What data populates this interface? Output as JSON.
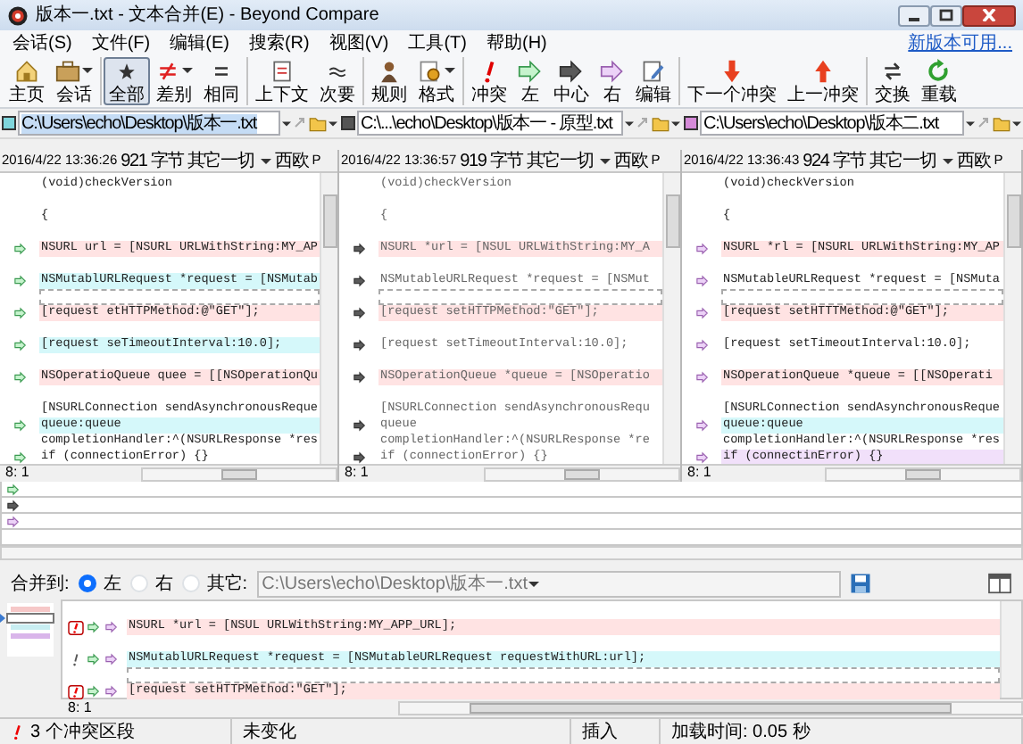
{
  "window": {
    "title": "版本一.txt - 文本合并(E) - Beyond Compare"
  },
  "menu": [
    "会话(S)",
    "文件(F)",
    "编辑(E)",
    "搜索(R)",
    "视图(V)",
    "工具(T)",
    "帮助(H)"
  ],
  "update_link": "新版本可用...",
  "toolbar": [
    [
      {
        "label": "主页",
        "kind": "home"
      },
      {
        "label": "会话",
        "kind": "session",
        "dropdown": true
      }
    ],
    [
      {
        "label": "全部",
        "kind": "all",
        "selected": true
      },
      {
        "label": "差别",
        "kind": "diff",
        "dropdown": true,
        "selected": false
      },
      {
        "label": "相同",
        "kind": "same",
        "selected": false
      }
    ],
    [
      {
        "label": "上下文",
        "kind": "context"
      },
      {
        "label": "次要",
        "kind": "minor"
      }
    ],
    [
      {
        "label": "规则",
        "kind": "rules"
      },
      {
        "label": "格式",
        "kind": "format",
        "dropdown": true
      }
    ],
    [
      {
        "label": "冲突",
        "kind": "conflict"
      },
      {
        "label": "左",
        "kind": "left"
      },
      {
        "label": "中心",
        "kind": "center"
      },
      {
        "label": "右",
        "kind": "right"
      },
      {
        "label": "编辑",
        "kind": "edit"
      }
    ],
    [
      {
        "label": "下一个冲突",
        "kind": "next"
      },
      {
        "label": "上一冲突",
        "kind": "prev"
      }
    ],
    [
      {
        "label": "交换",
        "kind": "swap"
      },
      {
        "label": "重载",
        "kind": "reload"
      }
    ]
  ],
  "panes": [
    {
      "kind": "left",
      "color": "#7fd6dc",
      "path": "C:\\Users\\echo\\Desktop\\版本一.txt",
      "path_selected": true,
      "date": "2016/4/22 13:36:26",
      "size": "921 字节",
      "filter": "其它一切",
      "encoding": "西欧",
      "mode": "P",
      "position": "8: 1",
      "lines": [
        {
          "text": "(void)checkVersion",
          "kind": "same",
          "arrow": false
        },
        {
          "kind": "same"
        },
        {
          "text": "{",
          "kind": "same",
          "arrow": false
        },
        {
          "kind": "same"
        },
        {
          "text": "NSURL url = [NSURL URLWithString:MY_AP",
          "kind": "conflict",
          "arrow": true
        },
        {
          "kind": "same"
        },
        {
          "text": "NSMutablURLRequest *request = [NSMutab",
          "kind": "left",
          "arrow": true
        },
        {
          "kind": "gap"
        },
        {
          "text": "[request etHTTPMethod:@\"GET\"];",
          "kind": "conflict",
          "arrow": true
        },
        {
          "kind": "same"
        },
        {
          "text": "[request seTimeoutInterval:10.0];",
          "kind": "left",
          "arrow": true
        },
        {
          "kind": "same"
        },
        {
          "text": "NSOperatioQueue quee = [[NSOperationQu",
          "kind": "conflict",
          "arrow": true
        },
        {
          "kind": "same"
        },
        {
          "text": "[NSURLConnection sendAsynchronousReque",
          "kind": "same",
          "arrow": false
        },
        {
          "text": "queue:queue",
          "kind": "left",
          "arrow": true
        },
        {
          "text": "completionHandler:^(NSURLResponse *res",
          "kind": "same",
          "arrow": false
        },
        {
          "text": "if (connectionError) {}",
          "kind": "same",
          "arrow": true
        }
      ]
    },
    {
      "kind": "base",
      "color": "#555555",
      "path": "C:\\...\\echo\\Desktop\\版本一 - 原型.txt",
      "path_selected": false,
      "date": "2016/4/22 13:36:57",
      "size": "919 字节",
      "filter": "其它一切",
      "encoding": "西欧",
      "mode": "P",
      "position": "8: 1",
      "lines": [
        {
          "text": "(void)checkVersion",
          "kind": "same",
          "arrow": false
        },
        {
          "kind": "same"
        },
        {
          "text": "{",
          "kind": "same",
          "arrow": false
        },
        {
          "kind": "same"
        },
        {
          "text": "NSURL *url = [NSUL URLWithString:MY_A",
          "kind": "conflict",
          "arrow": true
        },
        {
          "kind": "same"
        },
        {
          "text": "NSMutableURLRequest *request = [NSMut",
          "kind": "same",
          "arrow": true
        },
        {
          "kind": "gap"
        },
        {
          "text": "[request setHTTPMethod:\"GET\"];",
          "kind": "conflict",
          "arrow": true
        },
        {
          "kind": "same"
        },
        {
          "text": "[request setTimeoutInterval:10.0];",
          "kind": "same",
          "arrow": true
        },
        {
          "kind": "same"
        },
        {
          "text": "NSOperationQueue *queue = [NSOperatio",
          "kind": "conflict",
          "arrow": true
        },
        {
          "kind": "same"
        },
        {
          "text": "[NSURLConnection sendAsynchronousRequ",
          "kind": "same",
          "arrow": false
        },
        {
          "text": "queue",
          "kind": "same",
          "arrow": true
        },
        {
          "text": "completionHandler:^(NSURLResponse *re",
          "kind": "same",
          "arrow": false
        },
        {
          "text": "if (connectionError) {}",
          "kind": "same",
          "arrow": true
        }
      ]
    },
    {
      "kind": "right",
      "color": "#d58ad8",
      "path": "C:\\Users\\echo\\Desktop\\版本二.txt",
      "path_selected": false,
      "date": "2016/4/22 13:36:43",
      "size": "924 字节",
      "filter": "其它一切",
      "encoding": "西欧",
      "mode": "P",
      "position": "8: 1",
      "lines": [
        {
          "text": "(void)checkVersion",
          "kind": "same",
          "arrow": false
        },
        {
          "kind": "same"
        },
        {
          "text": "{",
          "kind": "same",
          "arrow": false
        },
        {
          "kind": "same"
        },
        {
          "text": "NSURL *rl = [NSURL URLWithString:MY_AP",
          "kind": "conflict",
          "arrow": true
        },
        {
          "kind": "same"
        },
        {
          "text": "NSMutableURLRequest *request = [NSMuta",
          "kind": "same",
          "arrow": true
        },
        {
          "kind": "gap"
        },
        {
          "text": "[request setHTTTMethod:@\"GET\"];",
          "kind": "conflict",
          "arrow": true
        },
        {
          "kind": "same"
        },
        {
          "text": "[request setTimeoutInterval:10.0];",
          "kind": "same",
          "arrow": true
        },
        {
          "kind": "same"
        },
        {
          "text": "NSOperationQueue *queue = [[NSOperati",
          "kind": "conflict",
          "arrow": true
        },
        {
          "kind": "same"
        },
        {
          "text": "[NSURLConnection sendAsynchronousReque",
          "kind": "same",
          "arrow": false
        },
        {
          "text": "queue:queue",
          "kind": "left",
          "arrow": true
        },
        {
          "text": "completionHandler:^(NSURLResponse *res",
          "kind": "same",
          "arrow": false
        },
        {
          "text": "if (connectinError) {}",
          "kind": "right",
          "arrow": true
        }
      ]
    }
  ],
  "detail_rows": [
    {
      "kind": "left"
    },
    {
      "kind": "base"
    },
    {
      "kind": "right"
    },
    {
      "kind": "output"
    }
  ],
  "merge": {
    "label": "合并到:",
    "options": [
      {
        "label": "左",
        "selected": true
      },
      {
        "label": "右",
        "selected": false
      },
      {
        "label": "其它:",
        "selected": false
      }
    ],
    "path": "C:\\Users\\echo\\Desktop\\版本一.txt"
  },
  "output": {
    "position": "8: 1",
    "lines": [
      {
        "kind": "same"
      },
      {
        "text": "NSURL *url = [NSUL URLWithString:MY_APP_URL];",
        "kind": "conflict"
      },
      {
        "kind": "same"
      },
      {
        "text": "NSMutablURLRequest *request = [NSMutableURLRequest requestWithURL:url];",
        "kind": "change"
      },
      {
        "kind": "gap"
      },
      {
        "text": "[request setHTTPMethod:\"GET\"];",
        "kind": "conflict"
      }
    ]
  },
  "status": [
    {
      "kind": "conflict",
      "text": "3 个冲突区段"
    },
    {
      "kind": "text",
      "text": "未变化"
    },
    {
      "kind": "text",
      "text": "插入"
    },
    {
      "kind": "text",
      "text": "加载时间: 0.05 秒"
    }
  ]
}
